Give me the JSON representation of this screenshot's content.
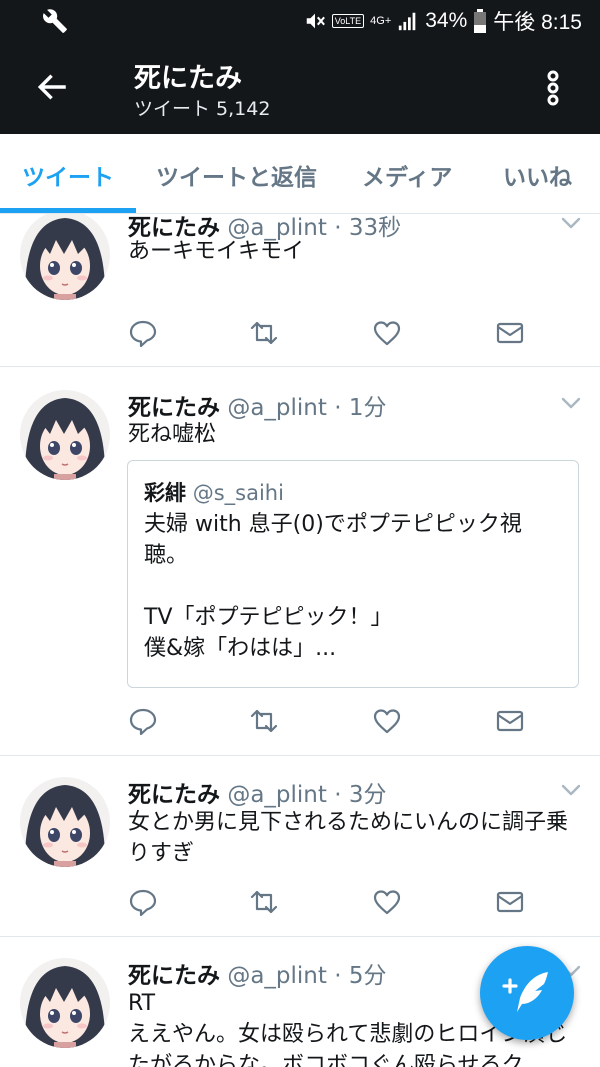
{
  "status_bar": {
    "icons": [
      "wrench-icon",
      "mute-icon",
      "volte-icon",
      "4g-icon",
      "signal-icon",
      "battery-icon"
    ],
    "volte": "VoLTE",
    "network": "4G+",
    "battery": "34%",
    "time": "午後 8:15"
  },
  "header": {
    "title": "死にたみ",
    "subtitle": "ツイート 5,142"
  },
  "tabs": [
    {
      "label": "ツイート",
      "active": true
    },
    {
      "label": "ツイートと返信",
      "active": false
    },
    {
      "label": "メディア",
      "active": false
    },
    {
      "label": "いいね",
      "active": false
    }
  ],
  "tweets": [
    {
      "name": "死にたみ",
      "handle": "@a_plint",
      "sep": "·",
      "time": "33秒",
      "text": "あーキモイキモイ"
    },
    {
      "name": "死にたみ",
      "handle": "@a_plint",
      "sep": "·",
      "time": "1分",
      "text": "死ね嘘松",
      "quote": {
        "name": "彩緋",
        "handle": "@s_saihi",
        "text": "夫婦 with 息子(0)でポプテピピック視聴。\n\nTV「ポプテピピック！」\n僕&嫁「わはは」..."
      }
    },
    {
      "name": "死にたみ",
      "handle": "@a_plint",
      "sep": "·",
      "time": "3分",
      "text": "女とか男に見下されるためにいんのに調子乗りすぎ"
    },
    {
      "name": "死にたみ",
      "handle": "@a_plint",
      "sep": "·",
      "time": "5分",
      "text": "RT\nええやん。女は殴られて悲劇のヒロイン演じたがるからな。ボコボコぐん殴らせるク"
    }
  ],
  "colors": {
    "bar": "#14171a",
    "accent": "#1da1f2",
    "secondary_text": "#657786",
    "divider": "#e1e8ed"
  }
}
